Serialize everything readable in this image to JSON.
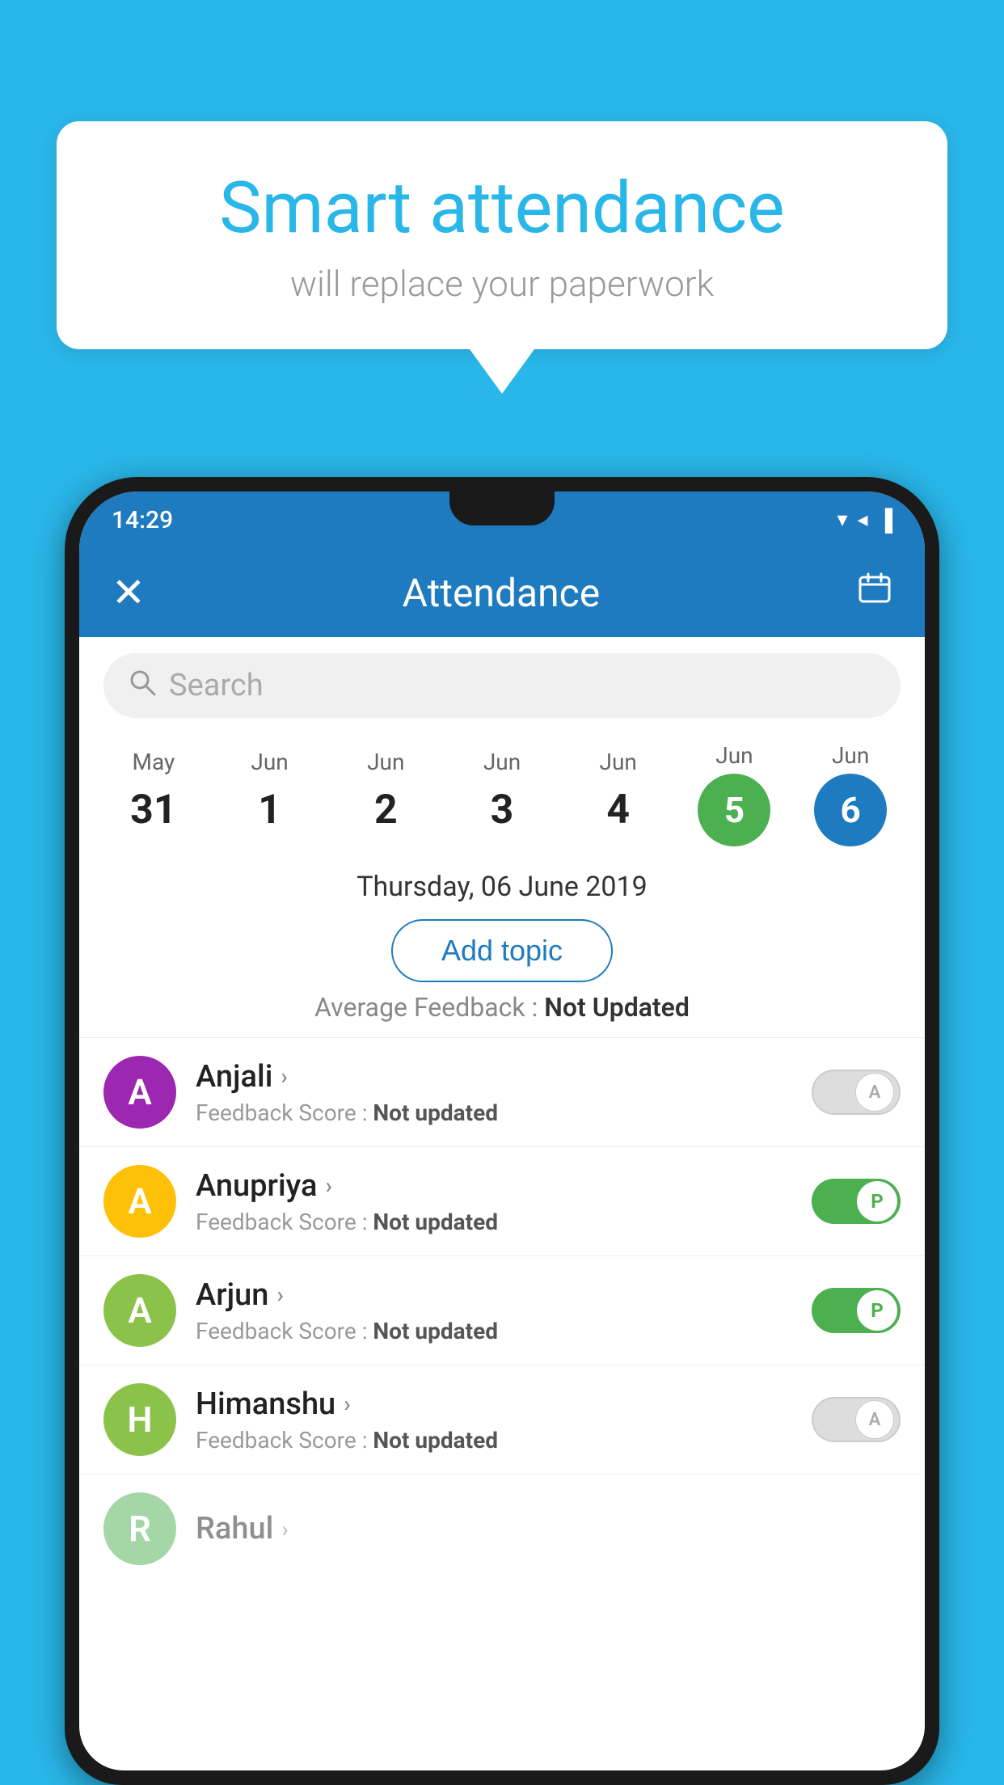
{
  "background_color": "#29B6E8",
  "speech_bubble": {
    "title": "Smart attendance",
    "subtitle": "will replace your paperwork"
  },
  "status_bar": {
    "time": "14:29",
    "signal_icons": "▼◄▐"
  },
  "app_bar": {
    "title": "Attendance",
    "close_icon": "✕",
    "calendar_icon": "📅"
  },
  "search": {
    "placeholder": "Search"
  },
  "calendar": {
    "columns": [
      {
        "month": "May",
        "day": "31",
        "type": "normal"
      },
      {
        "month": "Jun",
        "day": "1",
        "type": "normal"
      },
      {
        "month": "Jun",
        "day": "2",
        "type": "normal"
      },
      {
        "month": "Jun",
        "day": "3",
        "type": "normal"
      },
      {
        "month": "Jun",
        "day": "4",
        "type": "normal"
      },
      {
        "month": "Jun",
        "day": "5",
        "type": "green"
      },
      {
        "month": "Jun",
        "day": "6",
        "type": "blue"
      }
    ]
  },
  "selected_date": "Thursday, 06 June 2019",
  "add_topic_label": "Add topic",
  "average_feedback": {
    "label": "Average Feedback : ",
    "value": "Not Updated"
  },
  "students": [
    {
      "name": "Anjali",
      "feedback_label": "Feedback Score : ",
      "feedback_value": "Not updated",
      "avatar_letter": "A",
      "avatar_color": "#9C27B0",
      "toggle": "off",
      "toggle_letter": "A"
    },
    {
      "name": "Anupriya",
      "feedback_label": "Feedback Score : ",
      "feedback_value": "Not updated",
      "avatar_letter": "A",
      "avatar_color": "#FFC107",
      "toggle": "on",
      "toggle_letter": "P"
    },
    {
      "name": "Arjun",
      "feedback_label": "Feedback Score : ",
      "feedback_value": "Not updated",
      "avatar_letter": "A",
      "avatar_color": "#8BC34A",
      "toggle": "on",
      "toggle_letter": "P"
    },
    {
      "name": "Himanshu",
      "feedback_label": "Feedback Score : ",
      "feedback_value": "Not updated",
      "avatar_letter": "H",
      "avatar_color": "#8BC34A",
      "toggle": "off",
      "toggle_letter": "A"
    }
  ]
}
